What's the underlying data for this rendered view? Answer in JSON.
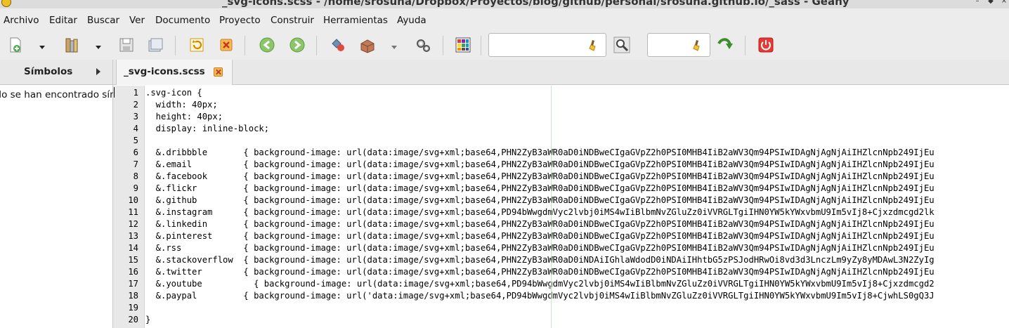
{
  "window": {
    "title": "_svg-icons.scss - /home/srosuna/Dropbox/Proyectos/blog/github/personal/srosuna.github.io/_sass - Geany"
  },
  "menu": [
    "Archivo",
    "Editar",
    "Buscar",
    "Ver",
    "Documento",
    "Proyecto",
    "Construir",
    "Herramientas",
    "Ayuda"
  ],
  "toolbar": {
    "search_value": "",
    "goto_value": ""
  },
  "sidebar": {
    "tab_label": "Símbolos",
    "empty_message": "No se han encontrado símbolos"
  },
  "editor": {
    "tab_label": "_svg-icons.scss",
    "line_numbers": [
      "1",
      "2",
      "3",
      "4",
      "5",
      "6",
      "7",
      "8",
      "9",
      "10",
      "11",
      "12",
      "13",
      "14",
      "15",
      "16",
      "17",
      "18",
      "19",
      "20"
    ],
    "lines": [
      ".svg-icon {",
      "  width: 40px;",
      "  height: 40px;",
      "  display: inline-block;",
      "",
      "  &.dribbble       { background-image: url(data:image/svg+xml;base64,PHN2ZyB3aWR0aD0iNDBweCIgaGVpZ2h0PSI0MHB4IiB2aWV3Qm94PSIwIDAgNjAgNjAiIHZlcnNpb249IjEu",
      "  &.email          { background-image: url(data:image/svg+xml;base64,PHN2ZyB3aWR0aD0iNDBweCIgaGVpZ2h0PSI0MHB4IiB2aWV3Qm94PSIwIDAgNjAgNjAiIHZlcnNpb249IjEu",
      "  &.facebook       { background-image: url(data:image/svg+xml;base64,PHN2ZyB3aWR0aD0iNDBweCIgaGVpZ2h0PSI0MHB4IiB2aWV3Qm94PSIwIDAgNjAgNjAiIHZlcnNpb249IjEu",
      "  &.flickr         { background-image: url(data:image/svg+xml;base64,PHN2ZyB3aWR0aD0iNDBweCIgaGVpZ2h0PSI0MHB4IiB2aWV3Qm94PSIwIDAgNjAgNjAiIHZlcnNpb249IjEu",
      "  &.github         { background-image: url(data:image/svg+xml;base64,PHN2ZyB3aWR0aD0iNDBweCIgaGVpZ2h0PSI0MHB4IiB2aWV3Qm94PSIwIDAgNjAgNjAiIHZlcnNpb249IjEu",
      "  &.instagram      { background-image: url(data:image/svg+xml;base64,PD94bWwgdmVyc2lvbj0iMS4wIiBlbmNvZGluZz0iVVRGLTgiIHN0YW5kYWxvbmU9Im5vIj8+Cjxzdmcgd2lk",
      "  &.linkedin       { background-image: url(data:image/svg+xml;base64,PHN2ZyB3aWR0aD0iNDBweCIgaGVpZ2h0PSI0MHB4IiB2aWV3Qm94PSIwIDAgNjAgNjAiIHZlcnNpb249IjEu",
      "  &.pinterest      { background-image: url(data:image/svg+xml;base64,PHN2ZyB3aWR0aD0iNDBweCIgaGVpZ2h0PSI0MHB4IiB2aWV3Qm94PSIwIDAgNjAgNjAiIHZlcnNpb249IjEu",
      "  &.rss            { background-image: url(data:image/svg+xml;base64,PHN2ZyB3aWR0aD0iNDBweCIgaGVpZ2h0PSI0MHB4IiB2aWV3Qm94PSIwIDAgNjAgNjAiIHZlcnNpb249IjEu",
      "  &.stackoverflow  { background-image: url(data:image/svg+xml;base64,PHN2ZyB3aWR0aD0iNDAiIGhlaWdodD0iNDAiIHhtbG5zPSJodHRwOi8vd3d3LnczLm9yZy8yMDAwL3N2ZyIg",
      "  &.twitter        { background-image: url(data:image/svg+xml;base64,PHN2ZyB3aWR0aD0iNDBweCIgaGVpZ2h0PSI0MHB4IiB2aWV3Qm94PSIwIDAgNjAgNjAiIHZlcnNpb249IjEu",
      "  &.youtube          { background-image: url(data:image/svg+xml;base64,PD94bWwgdmVyc2lvbj0iMS4wIiBlbmNvZGluZz0iVVRGLTgiIHN0YW5kYWxvbmU9Im5vIj8+Cjxzdmcgd2",
      "  &.paypal         { background-image: url('data:image/svg+xml;base64,PD94bWwgdmVyc2lvbj0iMS4wIiBlbmNvZGluZz0iVVRGLTgiIHN0YW5kYWxvbmU9Im5vIj8+CjwhLS0gQ3J",
      "",
      "}"
    ]
  }
}
